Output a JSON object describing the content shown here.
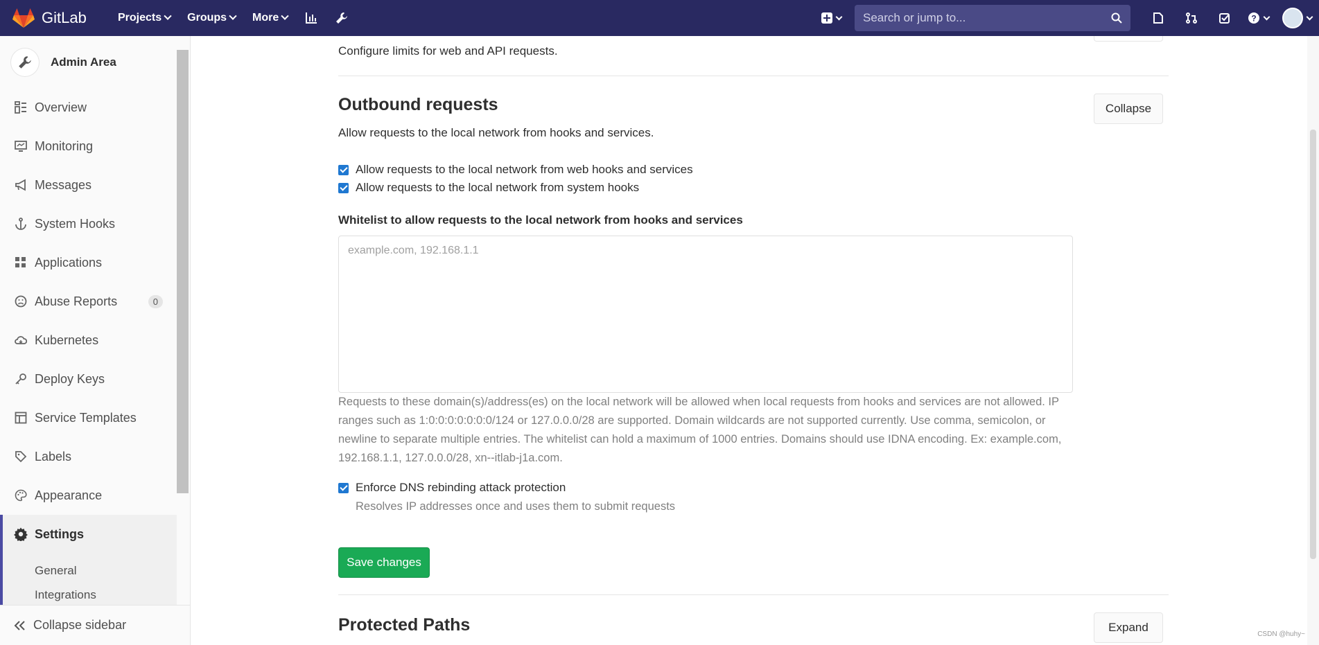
{
  "navbar": {
    "brand": "GitLab",
    "menu": [
      {
        "label": "Projects",
        "icon": "chevron-down-icon"
      },
      {
        "label": "Groups",
        "icon": "chevron-down-icon"
      },
      {
        "label": "More",
        "icon": "chevron-down-icon"
      }
    ],
    "search_placeholder": "Search or jump to...",
    "colors": {
      "bg": "#292961",
      "search_bg": "#4a4a86"
    }
  },
  "sidebar": {
    "title": "Admin Area",
    "items": [
      {
        "label": "Overview",
        "icon": "overview-icon"
      },
      {
        "label": "Monitoring",
        "icon": "monitor-icon"
      },
      {
        "label": "Messages",
        "icon": "megaphone-icon"
      },
      {
        "label": "System Hooks",
        "icon": "anchor-icon"
      },
      {
        "label": "Applications",
        "icon": "grid-icon"
      },
      {
        "label": "Abuse Reports",
        "icon": "sad-face-icon",
        "badge": "0"
      },
      {
        "label": "Kubernetes",
        "icon": "cloud-icon"
      },
      {
        "label": "Deploy Keys",
        "icon": "key-icon"
      },
      {
        "label": "Service Templates",
        "icon": "template-icon"
      },
      {
        "label": "Labels",
        "icon": "label-icon"
      },
      {
        "label": "Appearance",
        "icon": "palette-icon"
      }
    ],
    "active": {
      "label": "Settings",
      "icon": "gear-icon"
    },
    "sub_items": [
      "General",
      "Integrations"
    ],
    "collapse_label": "Collapse sidebar"
  },
  "content": {
    "prev_section_desc": "Configure limits for web and API requests.",
    "outbound": {
      "title": "Outbound requests",
      "button": "Collapse",
      "description": "Allow requests to the local network from hooks and services.",
      "checks": [
        {
          "label": "Allow requests to the local network from web hooks and services",
          "checked": true
        },
        {
          "label": "Allow requests to the local network from system hooks",
          "checked": true
        }
      ],
      "whitelist_label": "Whitelist to allow requests to the local network from hooks and services",
      "whitelist_placeholder": "example.com, 192.168.1.1",
      "whitelist_value": "",
      "whitelist_help": "Requests to these domain(s)/address(es) on the local network will be allowed when local requests from hooks and services are not allowed. IP ranges such as 1:0:0:0:0:0:0:0/124 or 127.0.0.0/28 are supported. Domain wildcards are not supported currently. Use comma, semicolon, or newline to separate multiple entries. The whitelist can hold a maximum of 1000 entries. Domains should use IDNA encoding. Ex: example.com, 192.168.1.1, 127.0.0.0/28, xn--itlab-j1a.com.",
      "dns_check": {
        "label": "Enforce DNS rebinding attack protection",
        "checked": true
      },
      "dns_help": "Resolves IP addresses once and uses them to submit requests",
      "save": "Save changes"
    },
    "protected_paths": {
      "title": "Protected Paths",
      "button": "Expand"
    }
  },
  "watermark": "CSDN @huhy~"
}
